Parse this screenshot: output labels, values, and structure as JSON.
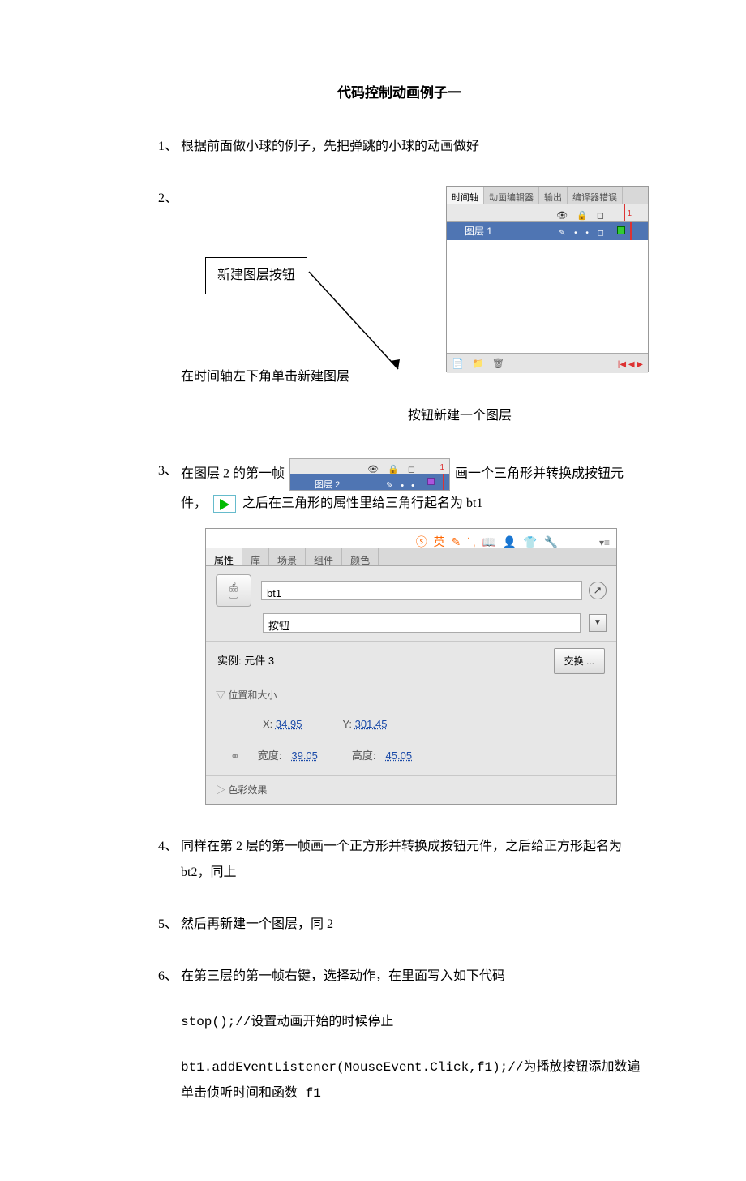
{
  "title": "代码控制动画例子一",
  "step1": {
    "num": "1、",
    "text": "根据前面做小球的例子，先把弹跳的小球的动画做好"
  },
  "step2": {
    "num": "2、",
    "callout": "新建图层按钮",
    "text_before": "在时间轴左下角单击新建图层",
    "text_after": "按钮新建一个图层",
    "fig": {
      "tabs": [
        "时间轴",
        "动画编辑器",
        "输出",
        "编译器错误"
      ],
      "head_icons": "👁 🔒 ◻",
      "frame1": "1",
      "layer_name": "图层 1",
      "layer_tools": "✎ • • ◻",
      "scrub": "|◀ ◀ ▶"
    }
  },
  "step3": {
    "num": "3、",
    "text_a": "在图层 2 的第一帧",
    "text_b": "画一个三角形并转换成按钮元件，",
    "text_c": "之后在三角形的属性里给三角行起名为 bt1",
    "strip": {
      "icons": "👁 🔒 ◻",
      "frame1": "1",
      "layer": "图层 2",
      "ricons": "✎ • •"
    },
    "props": {
      "ime": "ⓢ 英 ✎ ˙, 📖 👤 👕 🔧",
      "menu": "▾≡",
      "tabs": [
        "属性",
        "库",
        "场景",
        "组件",
        "颜色"
      ],
      "sym_icon": "🖱",
      "name_value": "bt1",
      "circ_icon": "↗",
      "type_value": "按钮",
      "dd_icon": "▼",
      "instance_label": "实例:",
      "instance_value": "元件 3",
      "swap_label": "交换 ...",
      "section_pos": "位置和大小",
      "x_label": "X:",
      "x_value": "34.95",
      "y_label": "Y:",
      "y_value": "301.45",
      "link_icon": "⚭",
      "w_label": "宽度:",
      "w_value": "39.05",
      "h_label": "高度:",
      "h_value": "45.05",
      "section_color": "色彩效果"
    }
  },
  "step4": {
    "num": "4、",
    "text": "同样在第 2 层的第一帧画一个正方形并转换成按钮元件，之后给正方形起名为 bt2，同上"
  },
  "step5": {
    "num": "5、",
    "text": "然后再新建一个图层，同 2"
  },
  "step6": {
    "num": "6、",
    "text": "在第三层的第一帧右键，选择动作，在里面写入如下代码",
    "code1": "stop();//设置动画开始的时候停止",
    "code2": "bt1.addEventListener(MouseEvent.Click,f1);//为播放按钮添加数遍单击侦听时间和函数 f1"
  }
}
